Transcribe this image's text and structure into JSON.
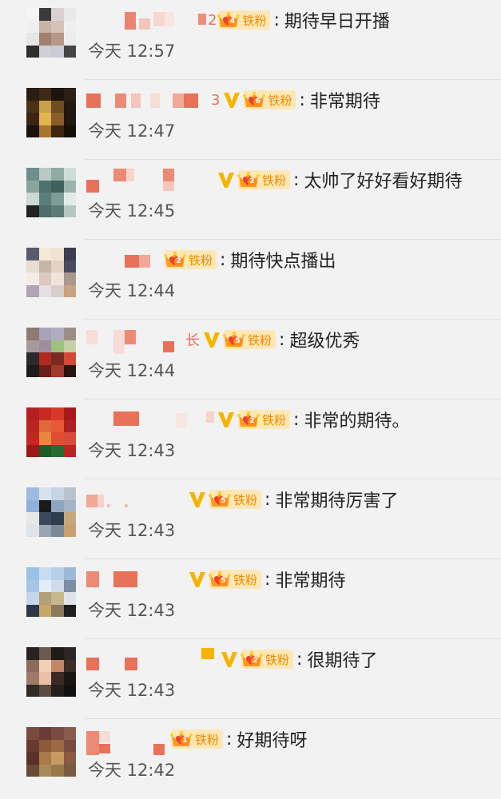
{
  "fan_badge_text": "铁粉",
  "colors": {
    "background": "#f2f2f2",
    "badge_bg": "#fde7b5",
    "badge_text": "#f08a00",
    "verified_v": "#f5b400",
    "name_blur": "#e8715a"
  },
  "comments": [
    {
      "time": "今天 12:57",
      "text": "期待早日开播",
      "fan_level": "4",
      "verified": false,
      "name_tail": "2"
    },
    {
      "time": "今天 12:47",
      "text": "非常期待",
      "fan_level": "6",
      "verified": true,
      "name_tail": "3"
    },
    {
      "time": "今天 12:45",
      "text": "太帅了好好看好期待",
      "fan_level": "2",
      "verified": true,
      "name_tail": ""
    },
    {
      "time": "今天 12:44",
      "text": "期待快点播出",
      "fan_level": "2",
      "verified": false,
      "name_tail": ""
    },
    {
      "time": "今天 12:44",
      "text": "超级优秀",
      "fan_level": "5",
      "verified": true,
      "name_tail": "长"
    },
    {
      "time": "今天 12:43",
      "text": "非常的期待。",
      "fan_level": "2",
      "verified": true,
      "name_tail": ""
    },
    {
      "time": "今天 12:43",
      "text": "非常期待厉害了",
      "fan_level": "5",
      "verified": true,
      "name_tail": ""
    },
    {
      "time": "今天 12:43",
      "text": "非常期待",
      "fan_level": "5",
      "verified": true,
      "name_tail": ""
    },
    {
      "time": "今天 12:43",
      "text": "很期待了",
      "fan_level": "2",
      "verified": true,
      "name_tail": ""
    },
    {
      "time": "今天 12:42",
      "text": "好期待呀",
      "fan_level": "1",
      "verified": false,
      "name_tail": ""
    }
  ]
}
